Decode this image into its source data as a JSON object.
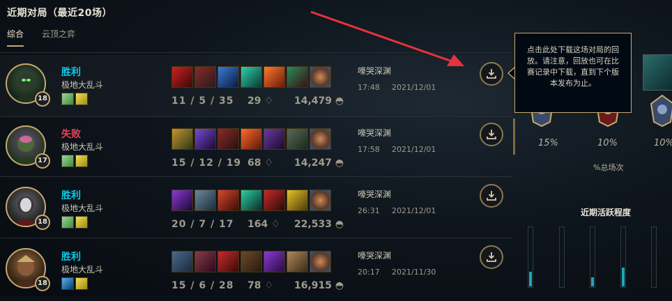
{
  "header": {
    "title": "近期对局（最近20场）",
    "tabs": [
      {
        "label": "综合",
        "active": true
      },
      {
        "label": "云顶之弈",
        "active": false
      }
    ]
  },
  "matches": [
    {
      "result": "胜利",
      "result_type": "win",
      "mode": "极地大乱斗",
      "level": "18",
      "kda": "11 / 5 / 35",
      "cs": "29",
      "gold": "14,479",
      "map": "嚎哭深渊",
      "time": "17:48",
      "date": "2021/12/01",
      "spell_icons": [
        "heal-spell-icon",
        "ghost-spell-icon"
      ],
      "item_icons": [
        "boots-item-icon",
        "item-icon",
        "item-icon",
        "item-icon",
        "item-icon",
        "item-icon",
        "poro-snax-trinket-icon"
      ]
    },
    {
      "result": "失败",
      "result_type": "loss",
      "mode": "极地大乱斗",
      "level": "17",
      "kda": "15 / 12 / 19",
      "cs": "68",
      "gold": "14,247",
      "map": "嚎哭深渊",
      "time": "17:58",
      "date": "2021/12/01",
      "spell_icons": [
        "heal-spell-icon",
        "ghost-spell-icon"
      ],
      "item_icons": [
        "item-icon",
        "item-icon",
        "boots-item-icon",
        "item-icon",
        "item-icon",
        "item-icon",
        "poro-snax-trinket-icon"
      ]
    },
    {
      "result": "胜利",
      "result_type": "win",
      "mode": "极地大乱斗",
      "level": "18",
      "kda": "20 / 7 / 17",
      "cs": "164",
      "gold": "22,533",
      "map": "嚎哭深渊",
      "time": "26:31",
      "date": "2021/12/01",
      "spell_icons": [
        "heal-spell-icon",
        "ghost-spell-icon"
      ],
      "item_icons": [
        "item-icon",
        "item-icon",
        "item-icon",
        "item-icon",
        "item-icon",
        "item-icon",
        "poro-snax-trinket-icon"
      ]
    },
    {
      "result": "胜利",
      "result_type": "win",
      "mode": "极地大乱斗",
      "level": "18",
      "kda": "15 / 6 / 28",
      "cs": "78",
      "gold": "16,915",
      "map": "嚎哭深渊",
      "time": "20:17",
      "date": "2021/11/30",
      "spell_icons": [
        "flash-spell-icon",
        "ghost-spell-icon"
      ],
      "item_icons": [
        "boots-item-icon",
        "item-icon",
        "item-icon",
        "item-icon",
        "item-icon",
        "item-icon",
        "poro-snax-trinket-icon"
      ]
    }
  ],
  "tooltip": {
    "text": "点击此处下载这场对局的回放。请注意，回放也可在比赛记录中下载，直到下个版本发布为止。"
  },
  "ranked_stats": {
    "percentages": [
      "15%",
      "10%",
      "10%"
    ],
    "caption": "%总场次"
  },
  "activity": {
    "title": "近期活跃程度",
    "levels": [
      0.25,
      0.0,
      0.15,
      0.32,
      0.0
    ]
  },
  "colors": {
    "win": "#0acbe6",
    "loss": "#e84057",
    "gold_border": "#c8aa6e",
    "annotation_arrow": "#e8323c"
  }
}
